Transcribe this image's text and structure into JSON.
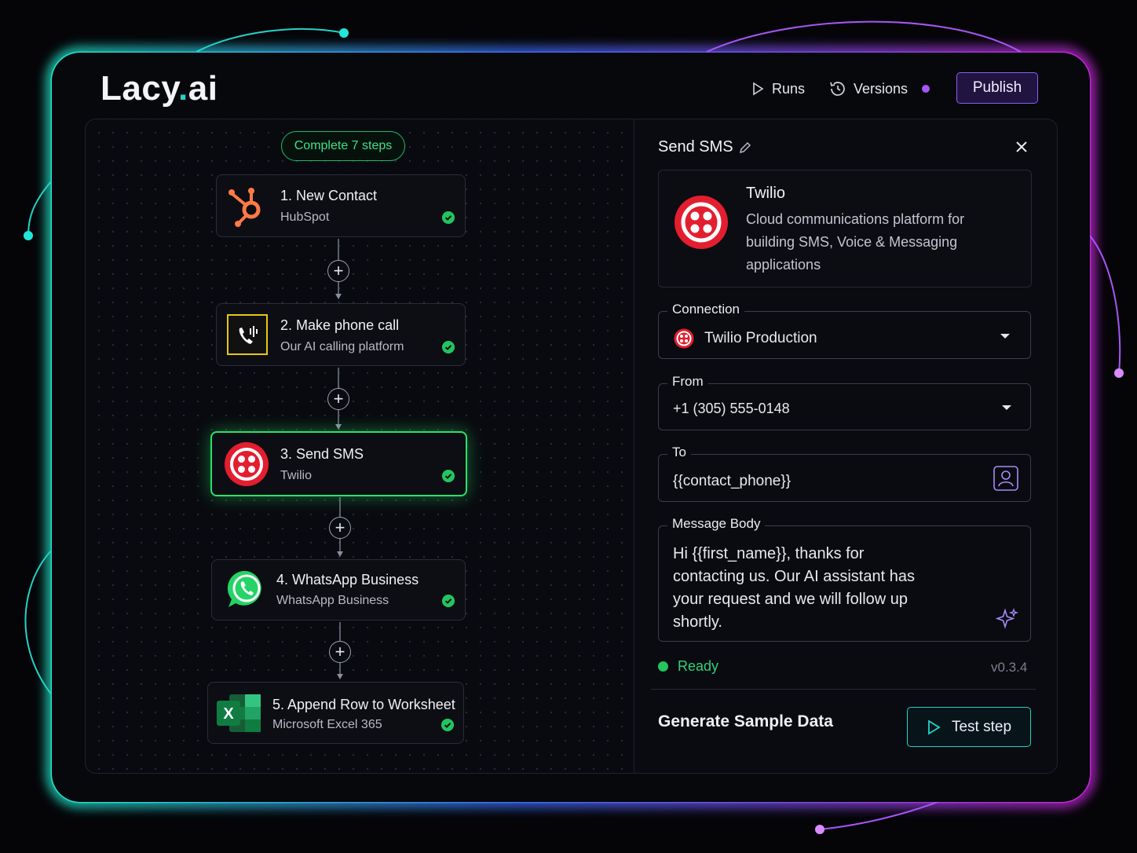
{
  "app": {
    "logo_text": "Lacy",
    "logo_dot": ".",
    "logo_suffix": "ai"
  },
  "header": {
    "runs_label": "Runs",
    "versions_label": "Versions",
    "publish_label": "Publish"
  },
  "workflow": {
    "progress_label": "Complete 7 steps",
    "steps": [
      {
        "title": "1. New Contact",
        "subtitle": "HubSpot",
        "icon": "hubspot-icon",
        "status": "complete"
      },
      {
        "title": "2. Make phone call",
        "subtitle": "Our AI calling platform",
        "icon": "phone-call-icon",
        "status": "complete"
      },
      {
        "title": "3. Send SMS",
        "subtitle": "Twilio",
        "icon": "twilio-icon",
        "status": "complete",
        "active": true
      },
      {
        "title": "4. WhatsApp Business",
        "subtitle": "WhatsApp Business",
        "icon": "whatsapp-icon",
        "status": "complete"
      },
      {
        "title": "5. Append Row to Worksheet",
        "subtitle": "Microsoft Excel 365",
        "icon": "excel-icon",
        "status": "complete"
      }
    ]
  },
  "panel": {
    "title": "Send SMS",
    "app_name": "Twilio",
    "app_description": "Cloud communications platform for building SMS, Voice & Messaging applications",
    "connection": {
      "label": "Connection",
      "value": "Twilio Production"
    },
    "from": {
      "label": "From",
      "value": "+1 (305) 555-0148"
    },
    "to": {
      "label": "To",
      "value": "{{contact_phone}}"
    },
    "message_body": {
      "label": "Message Body",
      "value": "Hi {{first_name}}, thanks for contacting us. Our AI assistant has your request and we will follow up shortly."
    },
    "status": "Ready",
    "version": "v0.3.4",
    "generate_label": "Generate Sample Data",
    "test_label": "Test step"
  },
  "colors": {
    "accent_green": "#22c55e",
    "accent_purple": "#8b5cf6",
    "accent_teal": "#22d3c8",
    "twilio_red": "#e31e2f",
    "hubspot_orange": "#ff7a45"
  }
}
